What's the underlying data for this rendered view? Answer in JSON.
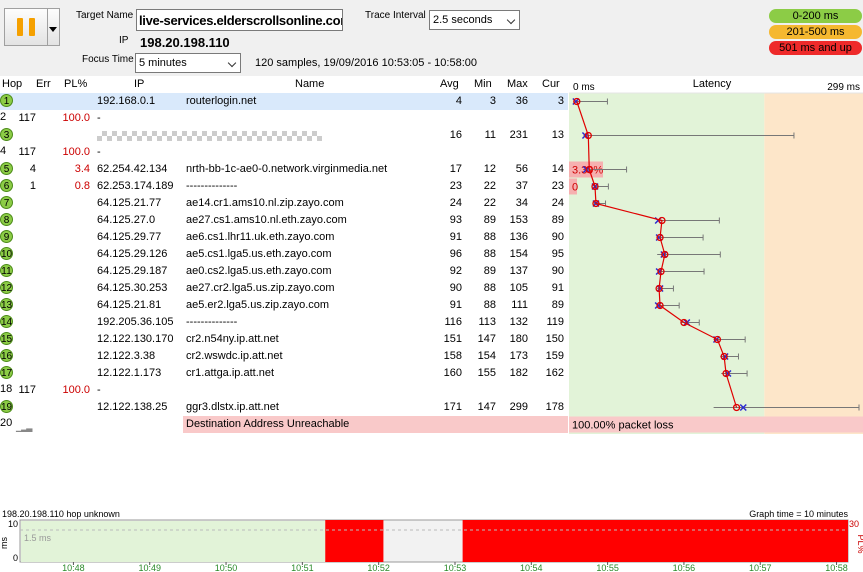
{
  "header": {
    "target_label": "Target Name",
    "target_value": "live-services.elderscrollsonline.com",
    "ip_label": "IP",
    "ip_value": "198.20.198.110",
    "focus_label": "Focus Time",
    "focus_value": "5 minutes",
    "interval_label": "Trace Interval",
    "interval_value": "2.5 seconds",
    "samples_text": "120 samples, 19/09/2016 10:53:05 - 10:58:00"
  },
  "legend": [
    {
      "label": "0-200 ms",
      "color": "#8ccc46"
    },
    {
      "label": "201-500 ms",
      "color": "#f5b830"
    },
    {
      "label": "501 ms and up",
      "color": "#ee2a2a"
    }
  ],
  "columns": [
    "Hop",
    "Err",
    "PL%",
    "IP",
    "Name",
    "Avg",
    "Min",
    "Max",
    "Cur"
  ],
  "latency_header": {
    "title": "Latency",
    "left": "0 ms",
    "right": "299 ms"
  },
  "hops": [
    {
      "hop": "1",
      "err": "",
      "pl": "",
      "ip": "192.168.0.1",
      "name": "routerlogin.net",
      "avg": "4",
      "min": "3",
      "max": "36",
      "cur": "3",
      "badge": true,
      "avgv": 4,
      "minv": 3,
      "maxv": 36,
      "curv": 3
    },
    {
      "hop": "2",
      "err": "117",
      "pl": "100.0",
      "ip": "-",
      "name": "",
      "avg": "",
      "min": "",
      "max": "",
      "cur": "",
      "badge": false
    },
    {
      "hop": "3",
      "err": "",
      "pl": "",
      "ip": "",
      "name": "",
      "avg": "16",
      "min": "11",
      "max": "231",
      "cur": "13",
      "badge": true,
      "masked": true,
      "avgv": 16,
      "minv": 11,
      "maxv": 231,
      "curv": 13
    },
    {
      "hop": "4",
      "err": "117",
      "pl": "100.0",
      "ip": "-",
      "name": "",
      "avg": "",
      "min": "",
      "max": "",
      "cur": "",
      "badge": false
    },
    {
      "hop": "5",
      "err": "4",
      "pl": "3.4",
      "ip": "62.254.42.134",
      "name": "nrth-bb-1c-ae0-0.network.virginmedia.net",
      "avg": "17",
      "min": "12",
      "max": "56",
      "cur": "14",
      "badge": true,
      "avgv": 17,
      "minv": 12,
      "maxv": 56,
      "curv": 14,
      "plbar": "3.39%"
    },
    {
      "hop": "6",
      "err": "1",
      "pl": "0.8",
      "ip": "62.253.174.189",
      "name": "--------------",
      "avg": "23",
      "min": "22",
      "max": "37",
      "cur": "23",
      "badge": true,
      "avgv": 23,
      "minv": 22,
      "maxv": 37,
      "curv": 23,
      "plbar": "0"
    },
    {
      "hop": "7",
      "err": "",
      "pl": "",
      "ip": "64.125.21.77",
      "name": "ae14.cr1.ams10.nl.zip.zayo.com",
      "avg": "24",
      "min": "22",
      "max": "34",
      "cur": "24",
      "badge": true,
      "avgv": 24,
      "minv": 22,
      "maxv": 34,
      "curv": 24
    },
    {
      "hop": "8",
      "err": "",
      "pl": "",
      "ip": "64.125.27.0",
      "name": "ae27.cs1.ams10.nl.eth.zayo.com",
      "avg": "93",
      "min": "89",
      "max": "153",
      "cur": "89",
      "badge": true,
      "avgv": 93,
      "minv": 89,
      "maxv": 153,
      "curv": 89
    },
    {
      "hop": "9",
      "err": "",
      "pl": "",
      "ip": "64.125.29.77",
      "name": "ae6.cs1.lhr11.uk.eth.zayo.com",
      "avg": "91",
      "min": "88",
      "max": "136",
      "cur": "90",
      "badge": true,
      "avgv": 91,
      "minv": 88,
      "maxv": 136,
      "curv": 90
    },
    {
      "hop": "10",
      "err": "",
      "pl": "",
      "ip": "64.125.29.126",
      "name": "ae5.cs1.lga5.us.eth.zayo.com",
      "avg": "96",
      "min": "88",
      "max": "154",
      "cur": "95",
      "badge": true,
      "avgv": 96,
      "minv": 88,
      "maxv": 154,
      "curv": 95
    },
    {
      "hop": "11",
      "err": "",
      "pl": "",
      "ip": "64.125.29.187",
      "name": "ae0.cs2.lga5.us.eth.zayo.com",
      "avg": "92",
      "min": "89",
      "max": "137",
      "cur": "90",
      "badge": true,
      "avgv": 92,
      "minv": 89,
      "maxv": 137,
      "curv": 90
    },
    {
      "hop": "12",
      "err": "",
      "pl": "",
      "ip": "64.125.30.253",
      "name": "ae27.cr2.lga5.us.zip.zayo.com",
      "avg": "90",
      "min": "88",
      "max": "105",
      "cur": "91",
      "badge": true,
      "avgv": 90,
      "minv": 88,
      "maxv": 105,
      "curv": 91
    },
    {
      "hop": "13",
      "err": "",
      "pl": "",
      "ip": "64.125.21.81",
      "name": "ae5.er2.lga5.us.zip.zayo.com",
      "avg": "91",
      "min": "88",
      "max": "111",
      "cur": "89",
      "badge": true,
      "avgv": 91,
      "minv": 88,
      "maxv": 111,
      "curv": 89
    },
    {
      "hop": "14",
      "err": "",
      "pl": "",
      "ip": "192.205.36.105",
      "name": "--------------",
      "avg": "116",
      "min": "113",
      "max": "132",
      "cur": "119",
      "badge": true,
      "avgv": 116,
      "minv": 113,
      "maxv": 132,
      "curv": 119
    },
    {
      "hop": "15",
      "err": "",
      "pl": "",
      "ip": "12.122.130.170",
      "name": "cr2.n54ny.ip.att.net",
      "avg": "151",
      "min": "147",
      "max": "180",
      "cur": "150",
      "badge": true,
      "avgv": 151,
      "minv": 147,
      "maxv": 180,
      "curv": 150
    },
    {
      "hop": "16",
      "err": "",
      "pl": "",
      "ip": "12.122.3.38",
      "name": "cr2.wswdc.ip.att.net",
      "avg": "158",
      "min": "154",
      "max": "173",
      "cur": "159",
      "badge": true,
      "avgv": 158,
      "minv": 154,
      "maxv": 173,
      "curv": 159
    },
    {
      "hop": "17",
      "err": "",
      "pl": "",
      "ip": "12.122.1.173",
      "name": "cr1.attga.ip.att.net",
      "avg": "160",
      "min": "155",
      "max": "182",
      "cur": "162",
      "badge": true,
      "avgv": 160,
      "minv": 155,
      "maxv": 182,
      "curv": 162
    },
    {
      "hop": "18",
      "err": "117",
      "pl": "100.0",
      "ip": "-",
      "name": "",
      "avg": "",
      "min": "",
      "max": "",
      "cur": "",
      "badge": false
    },
    {
      "hop": "19",
      "err": "",
      "pl": "",
      "ip": "12.122.138.25",
      "name": "ggr3.dlstx.ip.att.net",
      "avg": "171",
      "min": "147",
      "max": "299",
      "cur": "178",
      "badge": true,
      "avgv": 171,
      "minv": 147,
      "maxv": 299,
      "curv": 178
    },
    {
      "hop": "20",
      "err": "",
      "pl": "",
      "ip": "",
      "name": "Destination Address Unreachable",
      "avg": "",
      "min": "",
      "max": "",
      "cur": "",
      "badge": false,
      "unreachable": true,
      "plbar": "100.00% packet loss"
    }
  ],
  "timeline": {
    "title": "198.20.198.110 hop unknown",
    "graph_time": "Graph time = 10 minutes",
    "y_left_top": "10",
    "y_left_bottom": "0",
    "y_left_unit": "ms",
    "y_left_note": "1.5 ms",
    "y_right_top": "30",
    "y_right_unit": "PL%",
    "ticks": [
      "10:48",
      "10:49",
      "10:50",
      "10:51",
      "10:52",
      "10:53",
      "10:54",
      "10:55",
      "10:56",
      "10:57",
      "10:58"
    ],
    "loss_periods": [
      [
        "10:51.3",
        "10:51.8"
      ],
      [
        "10:53.1",
        "10:58"
      ]
    ]
  },
  "colors": {
    "selected_row": "#d9e9fb",
    "good_zone": "#e2f3d8",
    "warn_zone": "#fde6c9",
    "loss": "#ff0000",
    "unreachable": "#f9c9c9"
  }
}
